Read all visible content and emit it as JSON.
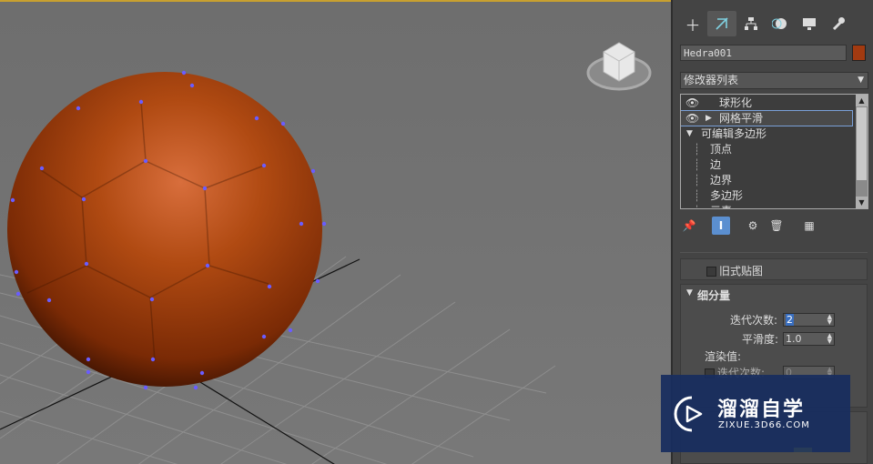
{
  "object_name": "Hedra001",
  "object_color": "#a23a10",
  "modifier_list": {
    "label": "修改器列表"
  },
  "stack": {
    "items": [
      {
        "label": "球形化",
        "eye": true,
        "arrow": false
      },
      {
        "label": "网格平滑",
        "eye": true,
        "arrow": true,
        "selected": true
      },
      {
        "label": "可编辑多边形",
        "eye": false,
        "arrow": true
      },
      {
        "label": "顶点",
        "sub": true
      },
      {
        "label": "边",
        "sub": true
      },
      {
        "label": "边界",
        "sub": true
      },
      {
        "label": "多边形",
        "sub": true
      },
      {
        "label": "元素",
        "sub": true
      }
    ]
  },
  "rollouts": {
    "legacy_mapping": "旧式贴图",
    "subdivision": {
      "title": "细分量",
      "iterations_label": "迭代次数:",
      "iterations_value": "2",
      "smoothness_label": "平滑度:",
      "smoothness_value": "1.0",
      "render_values_label": "渲染值:",
      "render_iterations_label": "迭代次数:",
      "render_iterations_value": "0"
    }
  },
  "watermark": {
    "brand": "溜溜自学",
    "url": "ZIXUE.3D66.COM"
  },
  "tabs": [
    "create-tab",
    "modify-tab",
    "hierarchy-tab",
    "motion-tab",
    "display-tab",
    "utilities-tab"
  ]
}
